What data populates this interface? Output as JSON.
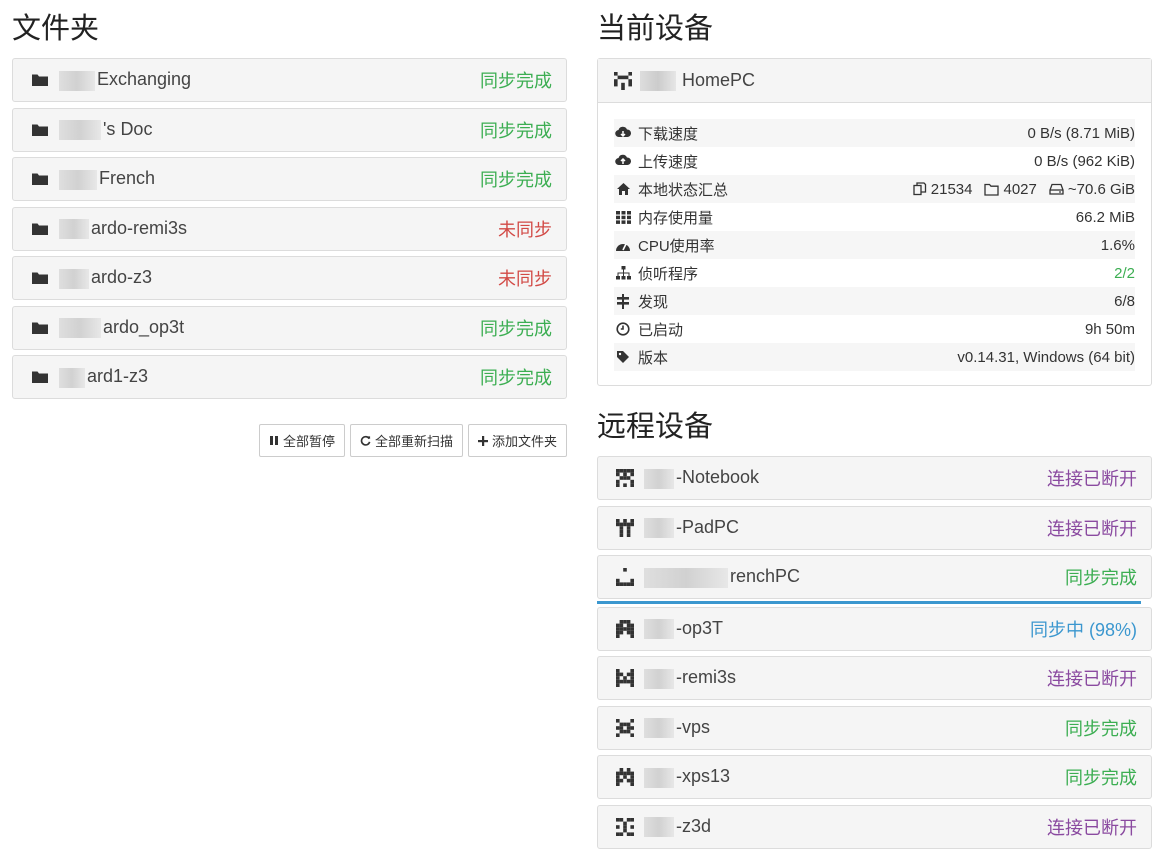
{
  "folders": {
    "title": "文件夹",
    "items": [
      {
        "name": "Exchanging",
        "status": "同步完成",
        "state": "green",
        "blur": 36
      },
      {
        "name": "'s Doc",
        "status": "同步完成",
        "state": "green",
        "blur": 42
      },
      {
        "name": "French",
        "status": "同步完成",
        "state": "green",
        "blur": 38
      },
      {
        "name": "ardo-remi3s",
        "status": "未同步",
        "state": "red",
        "blur": 30
      },
      {
        "name": "ardo-z3",
        "status": "未同步",
        "state": "red",
        "blur": 30
      },
      {
        "name": "ardo_op3t",
        "status": "同步完成",
        "state": "green",
        "blur": 42
      },
      {
        "name": "ard1-z3",
        "status": "同步完成",
        "state": "green",
        "blur": 26
      }
    ],
    "buttons": {
      "pause_all": "全部暂停",
      "rescan_all": "全部重新扫描",
      "add_folder": "添加文件夹"
    }
  },
  "this_device": {
    "title": "当前设备",
    "name": "HomePC",
    "stats": [
      {
        "icon": "cloud-download-icon",
        "label": "下载速度",
        "value": "0 B/s (8.71 MiB)"
      },
      {
        "icon": "cloud-upload-icon",
        "label": "上传速度",
        "value": "0 B/s (962 KiB)"
      },
      {
        "icon": "home-icon",
        "label": "本地状态汇总",
        "files": "21534",
        "dirs": "4027",
        "size": "~70.6 GiB"
      },
      {
        "icon": "memory-icon",
        "label": "内存使用量",
        "value": "66.2 MiB"
      },
      {
        "icon": "dashboard-icon",
        "label": "CPU使用率",
        "value": "1.6%"
      },
      {
        "icon": "sitemap-icon",
        "label": "侦听程序",
        "value": "2/2",
        "value_color": "#3cae52"
      },
      {
        "icon": "signpost-icon",
        "label": "发现",
        "value": "6/8"
      },
      {
        "icon": "clock-icon",
        "label": "已启动",
        "value": "9h 50m"
      },
      {
        "icon": "tag-icon",
        "label": "版本",
        "value": "v0.14.31, Windows (64 bit)"
      }
    ]
  },
  "remote_devices": {
    "title": "远程设备",
    "items": [
      {
        "name": "-Notebook",
        "status": "连接已断开",
        "state": "purple",
        "blur": 30
      },
      {
        "name": "-PadPC",
        "status": "连接已断开",
        "state": "purple",
        "blur": 30
      },
      {
        "name": "renchPC",
        "status": "同步完成",
        "state": "green",
        "blur": 84
      },
      {
        "name": "-op3T",
        "status": "同步中 (98%)",
        "state": "blue",
        "blur": 30,
        "progress": 0.98
      },
      {
        "name": "-remi3s",
        "status": "连接已断开",
        "state": "purple",
        "blur": 30
      },
      {
        "name": "-vps",
        "status": "同步完成",
        "state": "green",
        "blur": 30
      },
      {
        "name": "-xps13",
        "status": "同步完成",
        "state": "green",
        "blur": 30
      },
      {
        "name": "-z3d",
        "status": "连接已断开",
        "state": "purple",
        "blur": 30
      }
    ]
  }
}
